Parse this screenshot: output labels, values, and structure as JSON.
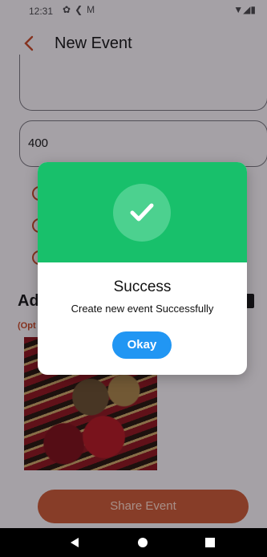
{
  "status_bar": {
    "time": "12:31",
    "icons": [
      "gear-icon",
      "share-icon",
      "gmail-icon"
    ],
    "right_icons": [
      "wifi-icon",
      "signal-icon",
      "battery-icon"
    ]
  },
  "app_bar": {
    "title": "New Event",
    "back_icon": "back-arrow-icon"
  },
  "form": {
    "price_value": "400",
    "add_heading": "Ad",
    "optional_label": "(Opt"
  },
  "share_button": {
    "label": "Share Event"
  },
  "dialog": {
    "title": "Success",
    "message": "Create new event Successfully",
    "button_label": "Okay",
    "icon": "check-icon"
  },
  "colors": {
    "accent": "#c54a2e",
    "success": "#18c06b",
    "primary_button": "#2196f3"
  }
}
